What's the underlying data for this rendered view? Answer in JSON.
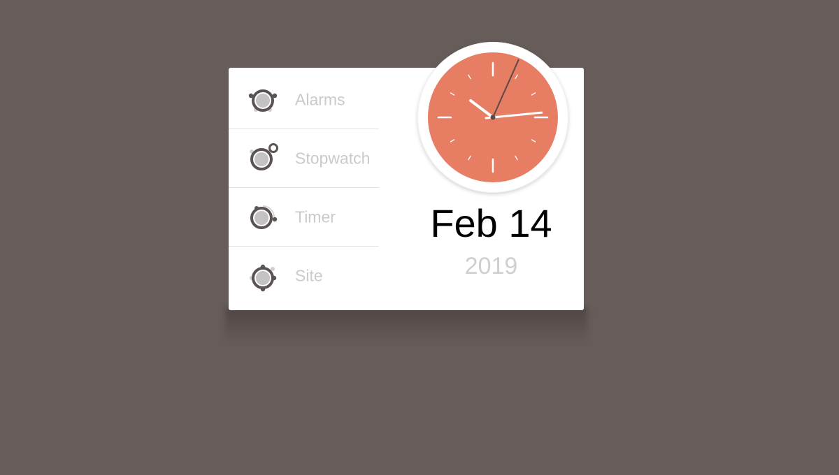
{
  "menu": {
    "items": [
      {
        "label": "Alarms",
        "icon": "alarm-clock-icon"
      },
      {
        "label": "Stopwatch",
        "icon": "stopwatch-icon"
      },
      {
        "label": "Timer",
        "icon": "timer-icon"
      },
      {
        "label": "Site",
        "icon": "site-gear-icon"
      }
    ]
  },
  "date": {
    "month_day": "Feb 14",
    "year": "2019"
  },
  "clock": {
    "hour": 10,
    "minute": 14,
    "second": 4
  },
  "colors": {
    "background": "#665c5a",
    "card": "#ffffff",
    "clock_face": "#e77d62",
    "icon_dark": "#5a5352",
    "icon_fill": "#c4c2c2",
    "label": "#cacaca",
    "year": "#cfcfcf"
  }
}
